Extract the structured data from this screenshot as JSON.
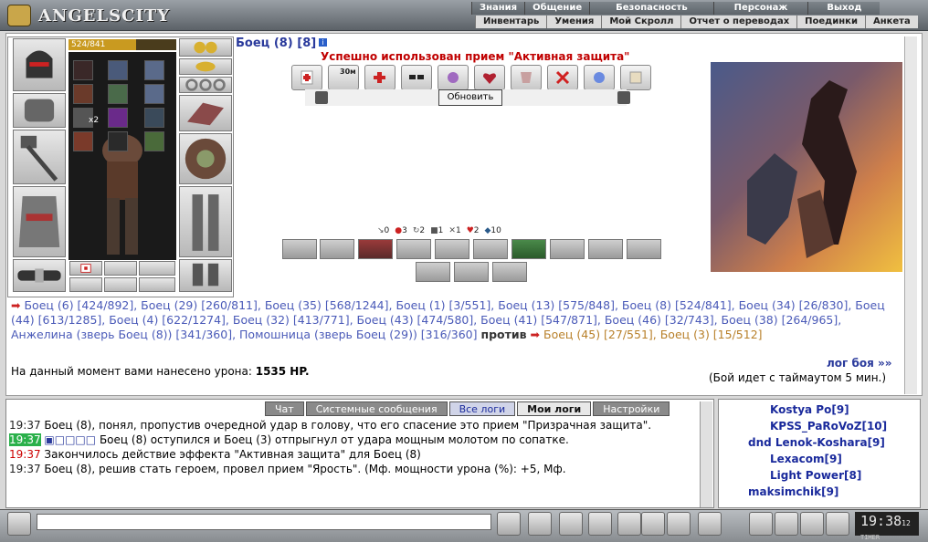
{
  "logo": "ANGELSCITY",
  "menu1": [
    "Знания",
    "Общение",
    "Безопасность",
    "Персонаж",
    "Выход"
  ],
  "menu2": [
    "Инвентарь",
    "Умения",
    "Мой Скролл",
    "Отчет о переводах",
    "Поединки",
    "Анкета"
  ],
  "hp": {
    "text": "524/841",
    "fraction": 0.623
  },
  "fight": {
    "title": "Боец (8) [8]",
    "success": "Успешно использован прием \"Активная защита\"",
    "refresh": "Обновить",
    "stats": [
      "0",
      "3",
      "2",
      "1",
      "1",
      "2",
      "10"
    ],
    "badge": "x2",
    "timer_badge": "30м"
  },
  "fighters": {
    "line": "Боец (6) [424/892], Боец (29) [260/811], Боец (35) [568/1244], Боец (1) [3/551], Боец (13) [575/848], Боец (8) [524/841], Боец (34) [26/830], Боец (44) [613/1285], Боец (4) [622/1274], Боец (32) [413/771], Боец (43) [474/580], Боец (41) [547/871], Боец (46) [32/743], Боец (38) [264/965], Анжелина (зверь Боец (8)) [341/360], Помошница (зверь Боец (29)) [316/360]",
    "versus": "против",
    "enemies": "Боец (45) [27/551], Боец (3) [15/512]"
  },
  "damage": {
    "label": "На данный момент вами нанесено урона:",
    "value": "1535 HP."
  },
  "loglink": "лог боя »»",
  "timeout": "(Бой идет с таймаутом 5 мин.)",
  "tabs": [
    "Чат",
    "Системные сообщения",
    "Все логи",
    "Мои логи",
    "Настройки"
  ],
  "log": [
    {
      "time": "19:37",
      "text": "Боец (8), понял, пропустив очередной удар в голову, что его спасение это прием \"Призрачная защита\"."
    },
    {
      "time": "19:37",
      "text": "Боец (8) оступился и Боец (3) отпрыгнул от удара мощным молотом по сопатке."
    },
    {
      "time": "19:37",
      "text": "Закончилось действие эффекта \"Активная защита\" для Боец (8)"
    },
    {
      "time": "19:37",
      "text": "Боец (8), решив стать героем, провел прием \"Ярость\". (Мф. мощности урона (%): +5, Мф."
    }
  ],
  "online": [
    "Kostya Po[9]",
    "KPSS_PaRoVoZ[10]",
    "dnd Lenok-Koshara[9]",
    "Lexacom[9]",
    "Light Power[8]",
    "maksimchik[9]"
  ],
  "clock": {
    "time": "19:38",
    "sec": "12",
    "label": "TIMER"
  },
  "colors": {
    "fighter": "#4a5ab8",
    "enemy": "#b8802a",
    "time_red": "#c00000",
    "time_green": "#2ab04a"
  }
}
